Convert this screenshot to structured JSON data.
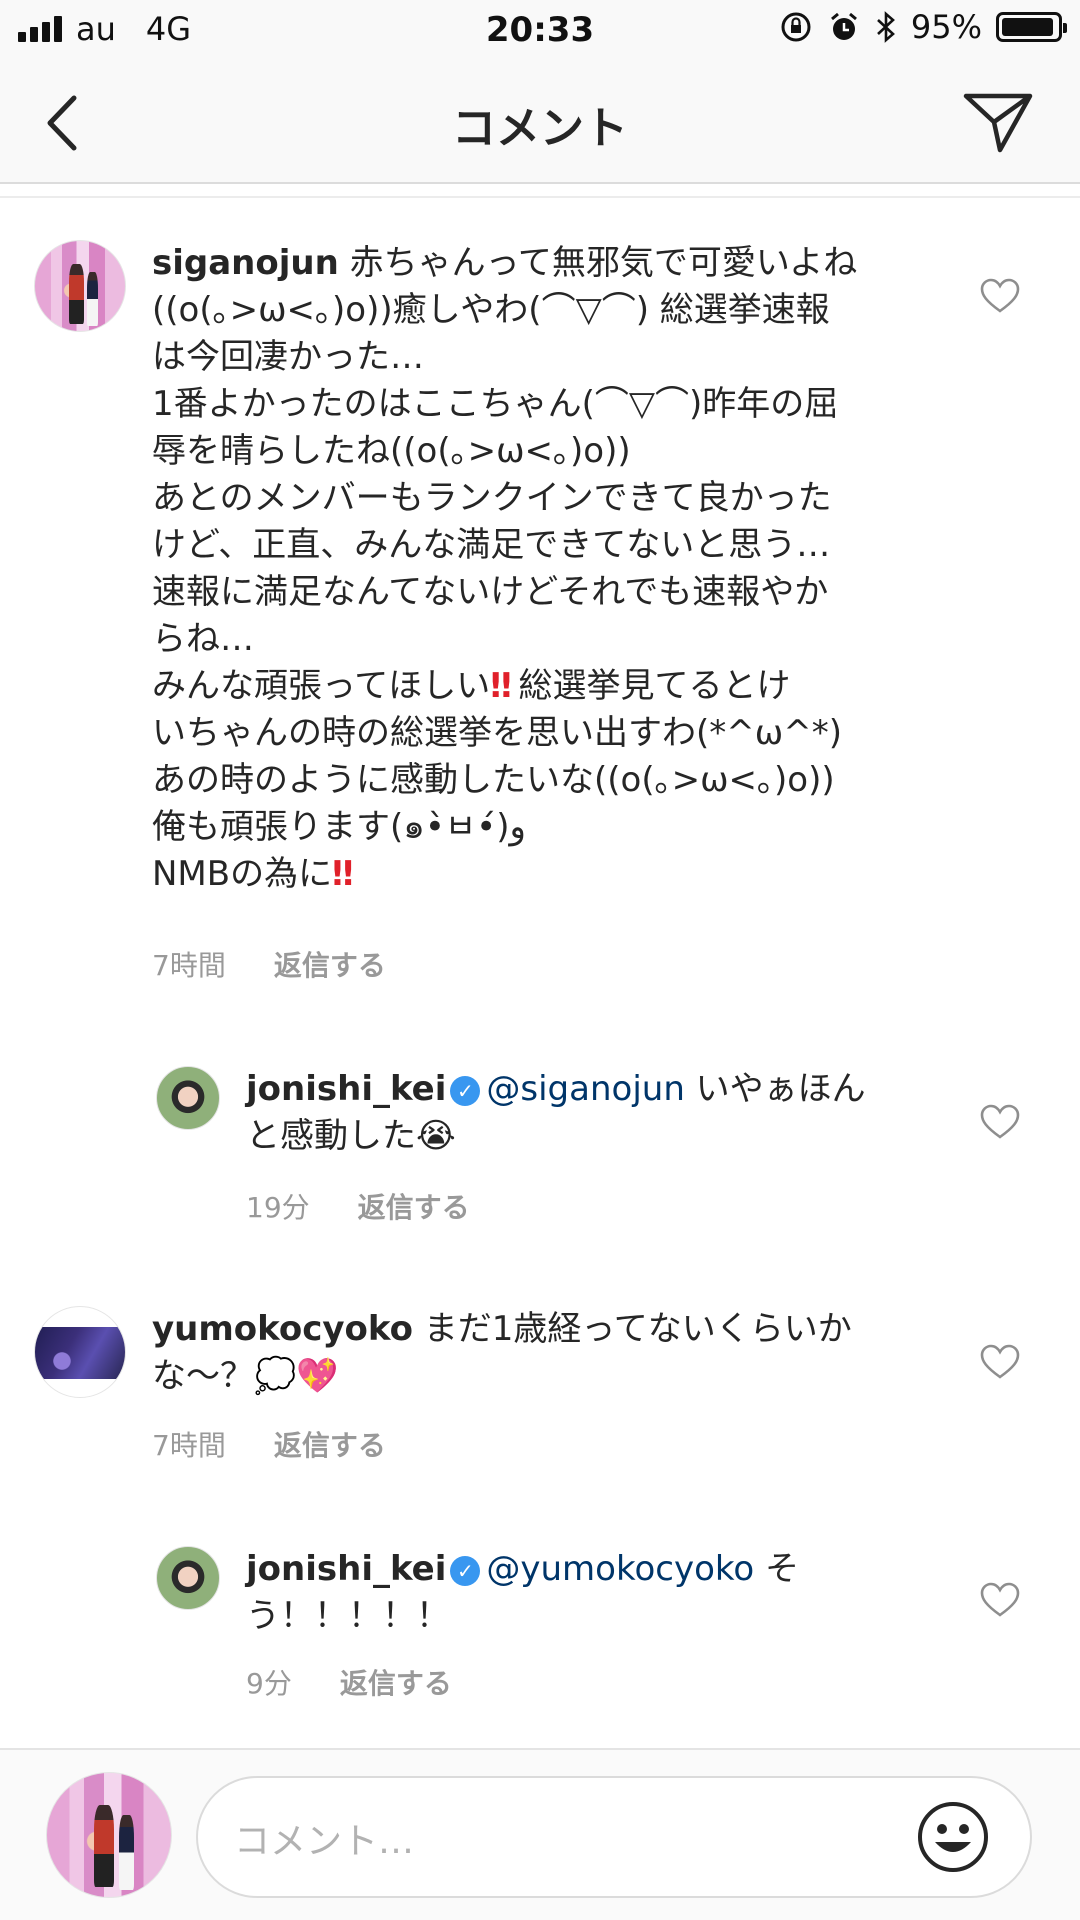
{
  "status_bar": {
    "carrier": "au",
    "network": "4G",
    "time": "20:33",
    "battery": "95%",
    "battery_level": 0.95,
    "icons": [
      "signal-icon",
      "rotation-lock-icon",
      "alarm-icon",
      "bluetooth-icon",
      "battery-icon"
    ]
  },
  "nav": {
    "title": "コメント",
    "back_icon": "chevron-left-icon",
    "send_icon": "paper-plane-icon"
  },
  "comments": [
    {
      "username": "siganojun",
      "lines": [
        "赤ちゃんって無邪気で可愛いよね",
        "((o(｡>ω<｡)o))癒しやわ(⌒▽⌒) 総選挙速報",
        "は今回凄かった…",
        "1番よかったのはここちゃん(⌒▽⌒)昨年の屈",
        "辱を晴らしたね((o(｡>ω<｡)o))",
        "あとのメンバーもランクインできて良かった",
        "けど、正直、みんな満足できてないと思う…",
        "速報に満足なんてないけどそれでも速報やか",
        "らね…",
        "みんな頑張ってほしい",
        "総選挙見てるとけ",
        "いちゃんの時の総選挙を思い出すわ(*^ω^*)",
        "あの時のように感動したいな((o(｡>ω<｡)o))",
        "俺も頑張ります(๑•̀ㅂ•́)و",
        "NMBの為に"
      ],
      "exclaim": "‼",
      "time": "7時間",
      "reply_label": "返信する"
    },
    {
      "username": "jonishi_kei",
      "verified": true,
      "mention": "@siganojun",
      "text_1": " いやぁほん",
      "text_2": "と感動した",
      "emoji": "😭",
      "time": "19分",
      "reply_label": "返信する"
    },
    {
      "username": "yumokocyoko",
      "text_1": " まだ1歳経ってないくらいか",
      "text_2": "な～？",
      "emoji_1": "💭",
      "emoji_2": "💖",
      "time": "7時間",
      "reply_label": "返信する"
    },
    {
      "username": "jonishi_kei",
      "verified": true,
      "mention": "@yumokocyoko",
      "text_1": " そ",
      "text_2": "う！！！！！",
      "time": "9分",
      "reply_label": "返信する"
    }
  ],
  "composer": {
    "placeholder": "コメント…",
    "emoji_icon": "smiley-icon"
  },
  "colors": {
    "mention": "#003569",
    "verified": "#3897f0",
    "meta": "#999999",
    "exclaim": "#e0202a"
  }
}
